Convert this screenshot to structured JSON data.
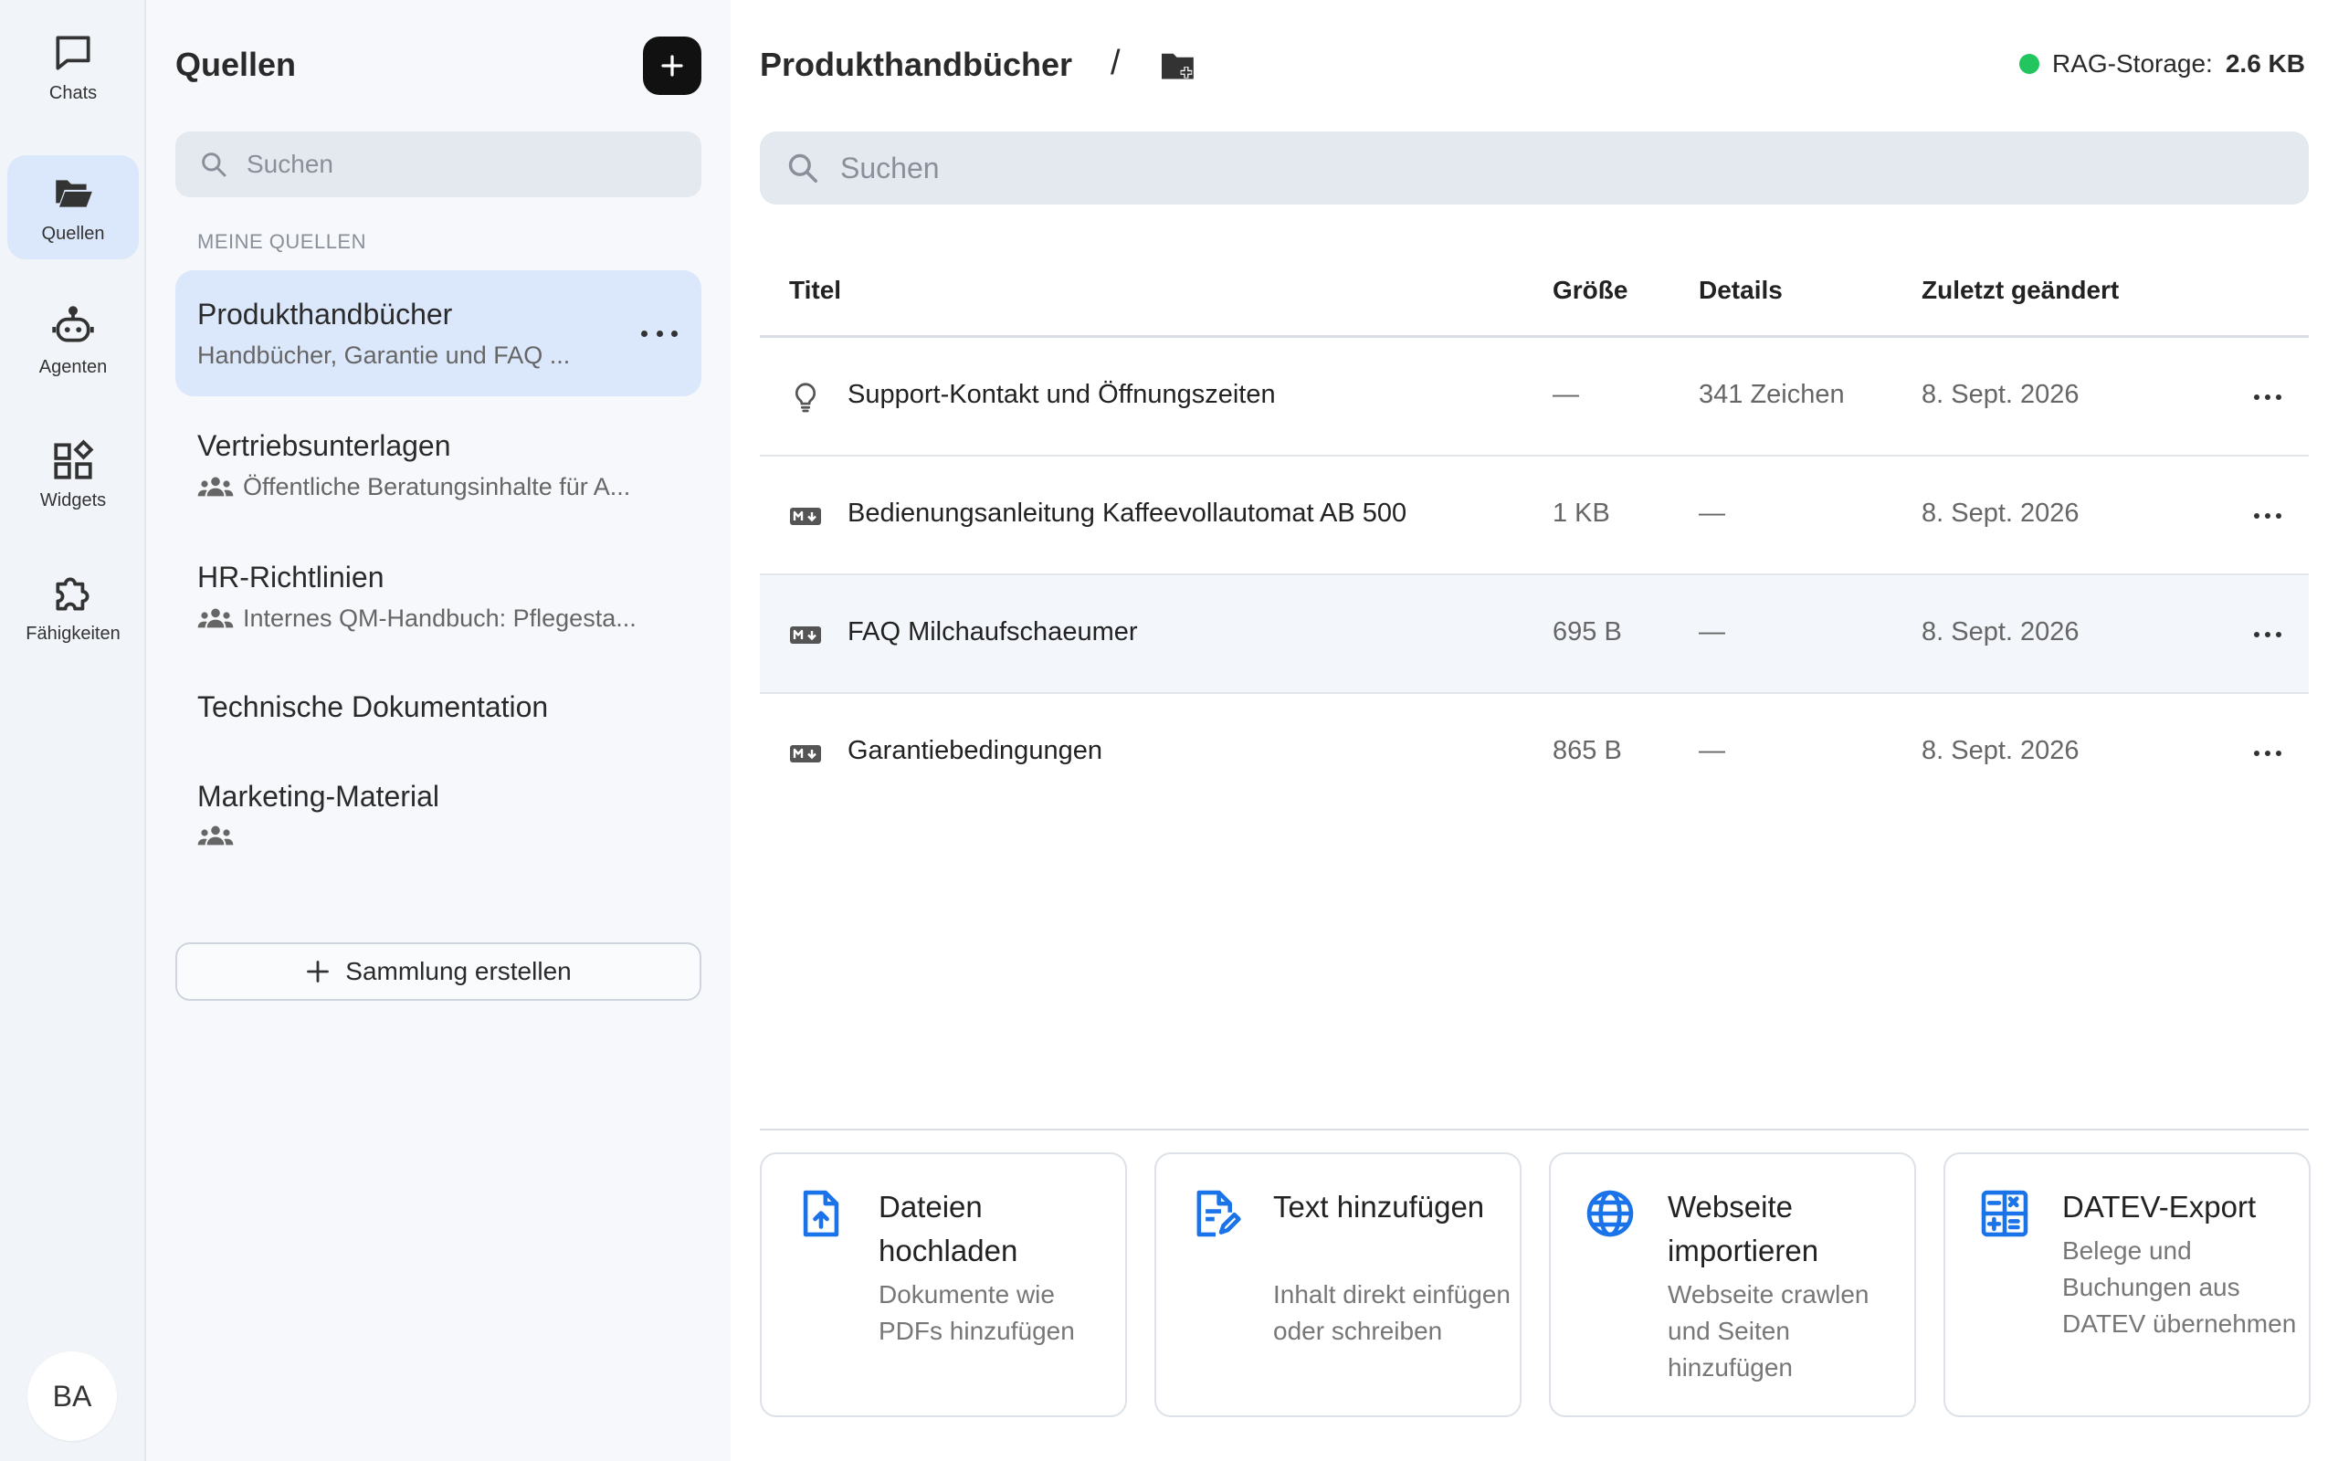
{
  "rail": {
    "items": [
      {
        "label": "Chats",
        "icon": "chat-bubble-icon"
      },
      {
        "label": "Quellen",
        "icon": "folder-open-icon",
        "active": true
      },
      {
        "label": "Agenten",
        "icon": "robot-icon"
      },
      {
        "label": "Widgets",
        "icon": "widgets-icon"
      },
      {
        "label": "Fähigkeiten",
        "icon": "puzzle-icon"
      }
    ],
    "avatar": "BA"
  },
  "sources": {
    "title": "Quellen",
    "search_placeholder": "Suchen",
    "section_label": "MEINE QUELLEN",
    "collections": [
      {
        "name": "Produkthandbücher",
        "description": "Handbücher, Garantie und FAQ ...",
        "shared": false,
        "active": true
      },
      {
        "name": "Vertriebsunterlagen",
        "description": "Öffentliche Beratungsinhalte für A...",
        "shared": true
      },
      {
        "name": "HR-Richtlinien",
        "description": "Internes QM-Handbuch: Pflegesta...",
        "shared": true
      },
      {
        "name": "Technische Dokumentation",
        "description": "",
        "shared": false
      },
      {
        "name": "Marketing-Material",
        "description": "",
        "shared": true
      }
    ],
    "create_label": "Sammlung erstellen"
  },
  "main": {
    "breadcrumb": "Produkthandbücher",
    "separator": "/",
    "storage_label": "RAG-Storage:",
    "storage_value": "2.6 KB",
    "storage_status_color": "#22c55e",
    "search_placeholder": "Suchen",
    "columns": {
      "title": "Titel",
      "size": "Größe",
      "details": "Details",
      "modified": "Zuletzt geändert"
    },
    "rows": [
      {
        "icon": "lightbulb-icon",
        "title": "Support-Kontakt und Öffnungszeiten",
        "size": "—",
        "details": "341 Zeichen",
        "modified": "8. Sept. 2026"
      },
      {
        "icon": "markdown-icon",
        "title": "Bedienungsanleitung Kaffeevollautomat AB 500",
        "size": "1 KB",
        "details": "—",
        "modified": "8. Sept. 2026"
      },
      {
        "icon": "markdown-icon",
        "title": "FAQ Milchaufschaeumer",
        "size": "695 B",
        "details": "—",
        "modified": "8. Sept. 2026",
        "highlighted": true
      },
      {
        "icon": "markdown-icon",
        "title": "Garantiebedingungen",
        "size": "865 B",
        "details": "—",
        "modified": "8. Sept. 2026"
      }
    ],
    "actions": [
      {
        "title": "Dateien hochladen",
        "description": "Dokumente wie PDFs hinzufügen",
        "icon": "file-upload-icon"
      },
      {
        "title": "Text hinzufügen",
        "description": "Inhalt direkt einfügen oder schreiben",
        "icon": "file-edit-icon"
      },
      {
        "title": "Webseite importieren",
        "description": "Webseite crawlen und Seiten hinzufügen",
        "icon": "globe-icon"
      },
      {
        "title": "DATEV-Export",
        "description": "Belege und Buchungen aus DATEV übernehmen",
        "icon": "calculator-icon"
      }
    ],
    "accent_color": "#1a73e8"
  }
}
